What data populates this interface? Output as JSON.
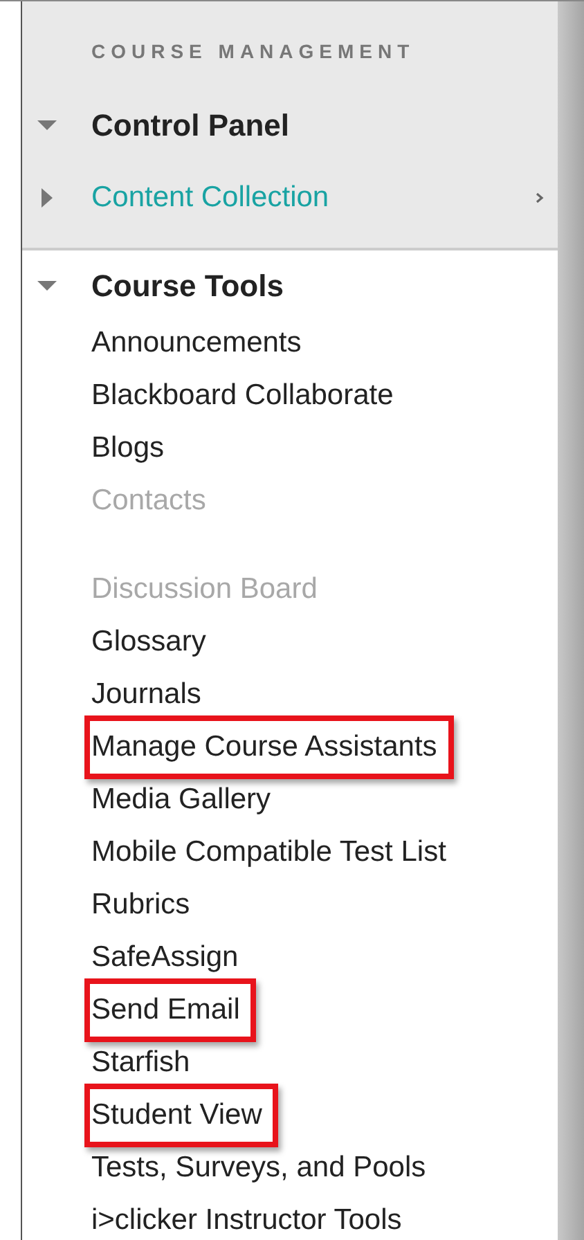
{
  "heading": "COURSE MANAGEMENT",
  "sections": [
    {
      "label": "Control Panel",
      "expanded": true,
      "kind": "header",
      "chevron": false
    },
    {
      "label": "Content Collection",
      "expanded": false,
      "kind": "link",
      "chevron": true
    }
  ],
  "course_tools": {
    "label": "Course Tools",
    "expanded": true,
    "items": [
      {
        "label": "Announcements",
        "faded": false,
        "highlighted": false
      },
      {
        "label": "Blackboard Collaborate",
        "faded": false,
        "highlighted": false
      },
      {
        "label": "Blogs",
        "faded": false,
        "highlighted": false
      },
      {
        "label": "Contacts",
        "faded": true,
        "highlighted": false
      },
      {
        "label": "Discussion Board",
        "faded": true,
        "highlighted": false
      },
      {
        "label": "Glossary",
        "faded": false,
        "highlighted": false
      },
      {
        "label": "Journals",
        "faded": false,
        "highlighted": false
      },
      {
        "label": "Manage Course Assistants",
        "faded": false,
        "highlighted": true
      },
      {
        "label": "Media Gallery",
        "faded": false,
        "highlighted": false
      },
      {
        "label": "Mobile Compatible Test List",
        "faded": false,
        "highlighted": false
      },
      {
        "label": "Rubrics",
        "faded": false,
        "highlighted": false
      },
      {
        "label": "SafeAssign",
        "faded": false,
        "highlighted": false
      },
      {
        "label": "Send Email",
        "faded": false,
        "highlighted": true
      },
      {
        "label": "Starfish",
        "faded": false,
        "highlighted": false
      },
      {
        "label": "Student View",
        "faded": false,
        "highlighted": true
      },
      {
        "label": "Tests, Surveys, and Pools",
        "faded": false,
        "highlighted": false
      },
      {
        "label": "i>clicker Instructor Tools",
        "faded": false,
        "highlighted": false
      }
    ]
  }
}
